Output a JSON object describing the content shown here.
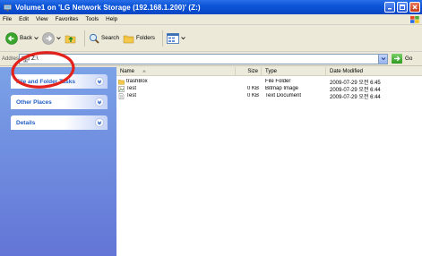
{
  "window": {
    "title": "Volume1 on 'LG Network Storage (192.168.1.200)' (Z:)"
  },
  "menu": [
    "File",
    "Edit",
    "View",
    "Favorites",
    "Tools",
    "Help"
  ],
  "toolbar": {
    "back_label": "Back",
    "search_label": "Search",
    "folders_label": "Folders"
  },
  "address": {
    "label": "Address",
    "value": "Z:\\",
    "go_label": "Go"
  },
  "tasks": {
    "file_folder": "File and Folder Tasks",
    "other_places": "Other Places",
    "details": "Details"
  },
  "columns": {
    "name": "Name",
    "size": "Size",
    "type": "Type",
    "date": "Date Modified"
  },
  "files": [
    {
      "name": "trashBox",
      "size": "",
      "type": "File Folder",
      "date": "2009-07-29 오전 6:45",
      "icon": "folder-icon"
    },
    {
      "name": "Test",
      "size": "0 KB",
      "type": "Bitmap Image",
      "date": "2009-07-29 오전 6:44",
      "icon": "bitmap-icon"
    },
    {
      "name": "Test",
      "size": "0 KB",
      "type": "Text Document",
      "date": "2009-07-29 오전 6:44",
      "icon": "text-document-icon"
    }
  ],
  "colors": {
    "titlebar": "#0c55d8",
    "task_pane": "#7ba2e7",
    "task_title": "#215dc6",
    "annotation_circle": "#e3231b"
  }
}
